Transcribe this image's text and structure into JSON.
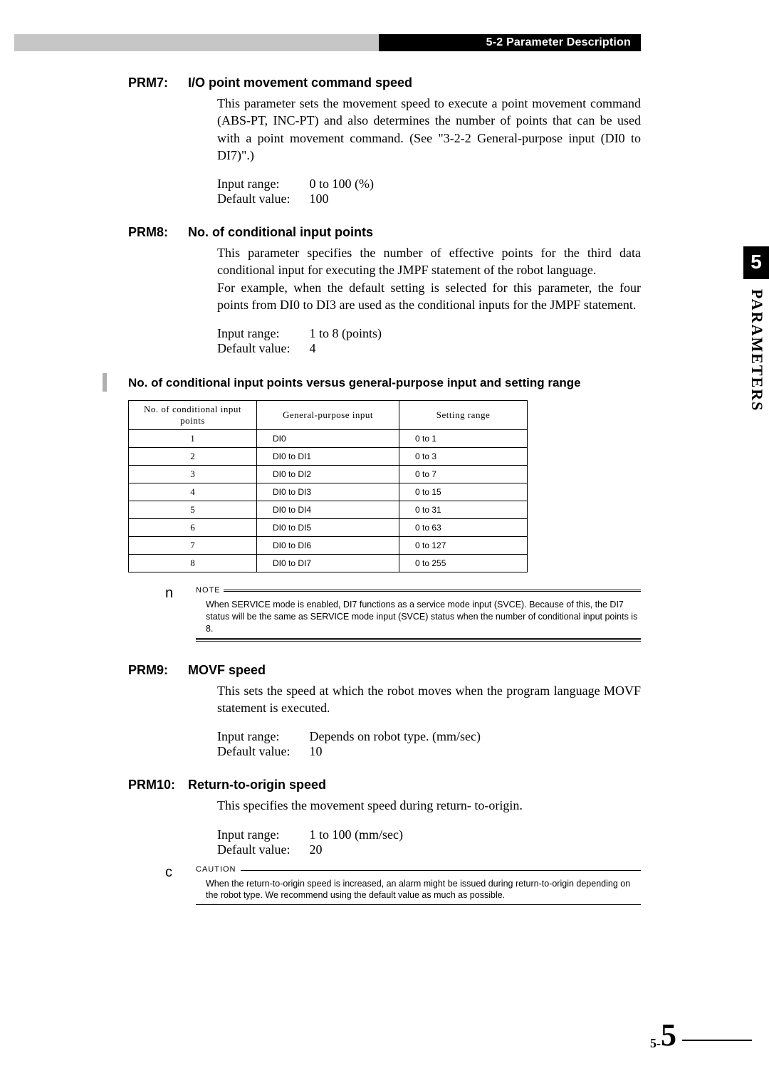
{
  "header": {
    "section_number": "5-2",
    "section_title": "Parameter Description"
  },
  "chapter": {
    "number": "5",
    "label": "PARAMETERS"
  },
  "page": {
    "chapter_part": "5-",
    "page_number": "5"
  },
  "prm7": {
    "label": "PRM7:",
    "title": "I/O point movement command speed",
    "body": "This parameter sets the movement speed to execute a point movement command (ABS-PT, INC-PT) and also determines the number of points that can be used with a point movement command. (See \"3-2-2 General-purpose input (DI0 to DI7)\".)",
    "input_range_label": "Input range:",
    "input_range_value": "0 to 100 (%)",
    "default_label": "Default value:",
    "default_value": "100"
  },
  "prm8": {
    "label": "PRM8:",
    "title": "No. of conditional input points",
    "body1": "This parameter specifies the number of effective points for the third data conditional input for executing the JMPF statement of the robot language.",
    "body2": "For example, when the default setting is selected for this parameter, the four points from DI0 to DI3 are used as the conditional inputs for the JMPF statement.",
    "input_range_label": "Input range:",
    "input_range_value": "1 to 8 (points)",
    "default_label": "Default value:",
    "default_value": "4",
    "table_title": "No. of conditional input points versus general-purpose input and setting range",
    "table_headers": {
      "col1": "No. of conditional input points",
      "col2": "General-purpose input",
      "col3": "Setting range"
    },
    "table_rows": [
      {
        "n": "1",
        "gp": "DI0",
        "sr": "0 to 1"
      },
      {
        "n": "2",
        "gp": "DI0 to DI1",
        "sr": "0 to 3"
      },
      {
        "n": "3",
        "gp": "DI0 to DI2",
        "sr": "0 to 7"
      },
      {
        "n": "4",
        "gp": "DI0 to DI3",
        "sr": "0 to 15"
      },
      {
        "n": "5",
        "gp": "DI0 to DI4",
        "sr": "0 to 31"
      },
      {
        "n": "6",
        "gp": "DI0 to DI5",
        "sr": "0 to 63"
      },
      {
        "n": "7",
        "gp": "DI0 to DI6",
        "sr": "0 to 127"
      },
      {
        "n": "8",
        "gp": "DI0 to DI7",
        "sr": "0 to 255"
      }
    ]
  },
  "note": {
    "marker": "n",
    "label": "NOTE",
    "text": "When SERVICE mode is enabled, DI7 functions as a service mode input (SVCE). Because of this, the DI7 status will be the same as SERVICE mode input (SVCE) status when the number of conditional input points is 8."
  },
  "prm9": {
    "label": "PRM9:",
    "title": "MOVF speed",
    "body": "This sets the speed at which the robot moves when the program language MOVF statement is executed.",
    "input_range_label": "Input range:",
    "input_range_value": "Depends on robot type. (mm/sec)",
    "default_label": "Default value:",
    "default_value": "10"
  },
  "prm10": {
    "label": "PRM10:",
    "title": "Return-to-origin speed",
    "body": "This specifies the movement speed during return- to-origin.",
    "input_range_label": "Input range:",
    "input_range_value": "1 to 100 (mm/sec)",
    "default_label": "Default value:",
    "default_value": "20"
  },
  "caution": {
    "marker": "c",
    "label": "CAUTION",
    "text": "When the return-to-origin speed is increased, an alarm might be issued during return-to-origin depending on the robot type. We recommend using the default value as much as possible."
  },
  "chart_data": {
    "type": "table",
    "title": "No. of conditional input points versus general-purpose input and setting range",
    "columns": [
      "No. of conditional input points",
      "General-purpose input",
      "Setting range"
    ],
    "rows": [
      [
        1,
        "DI0",
        "0 to 1"
      ],
      [
        2,
        "DI0 to DI1",
        "0 to 3"
      ],
      [
        3,
        "DI0 to DI2",
        "0 to 7"
      ],
      [
        4,
        "DI0 to DI3",
        "0 to 15"
      ],
      [
        5,
        "DI0 to DI4",
        "0 to 31"
      ],
      [
        6,
        "DI0 to DI5",
        "0 to 63"
      ],
      [
        7,
        "DI0 to DI6",
        "0 to 127"
      ],
      [
        8,
        "DI0 to DI7",
        "0 to 255"
      ]
    ]
  }
}
